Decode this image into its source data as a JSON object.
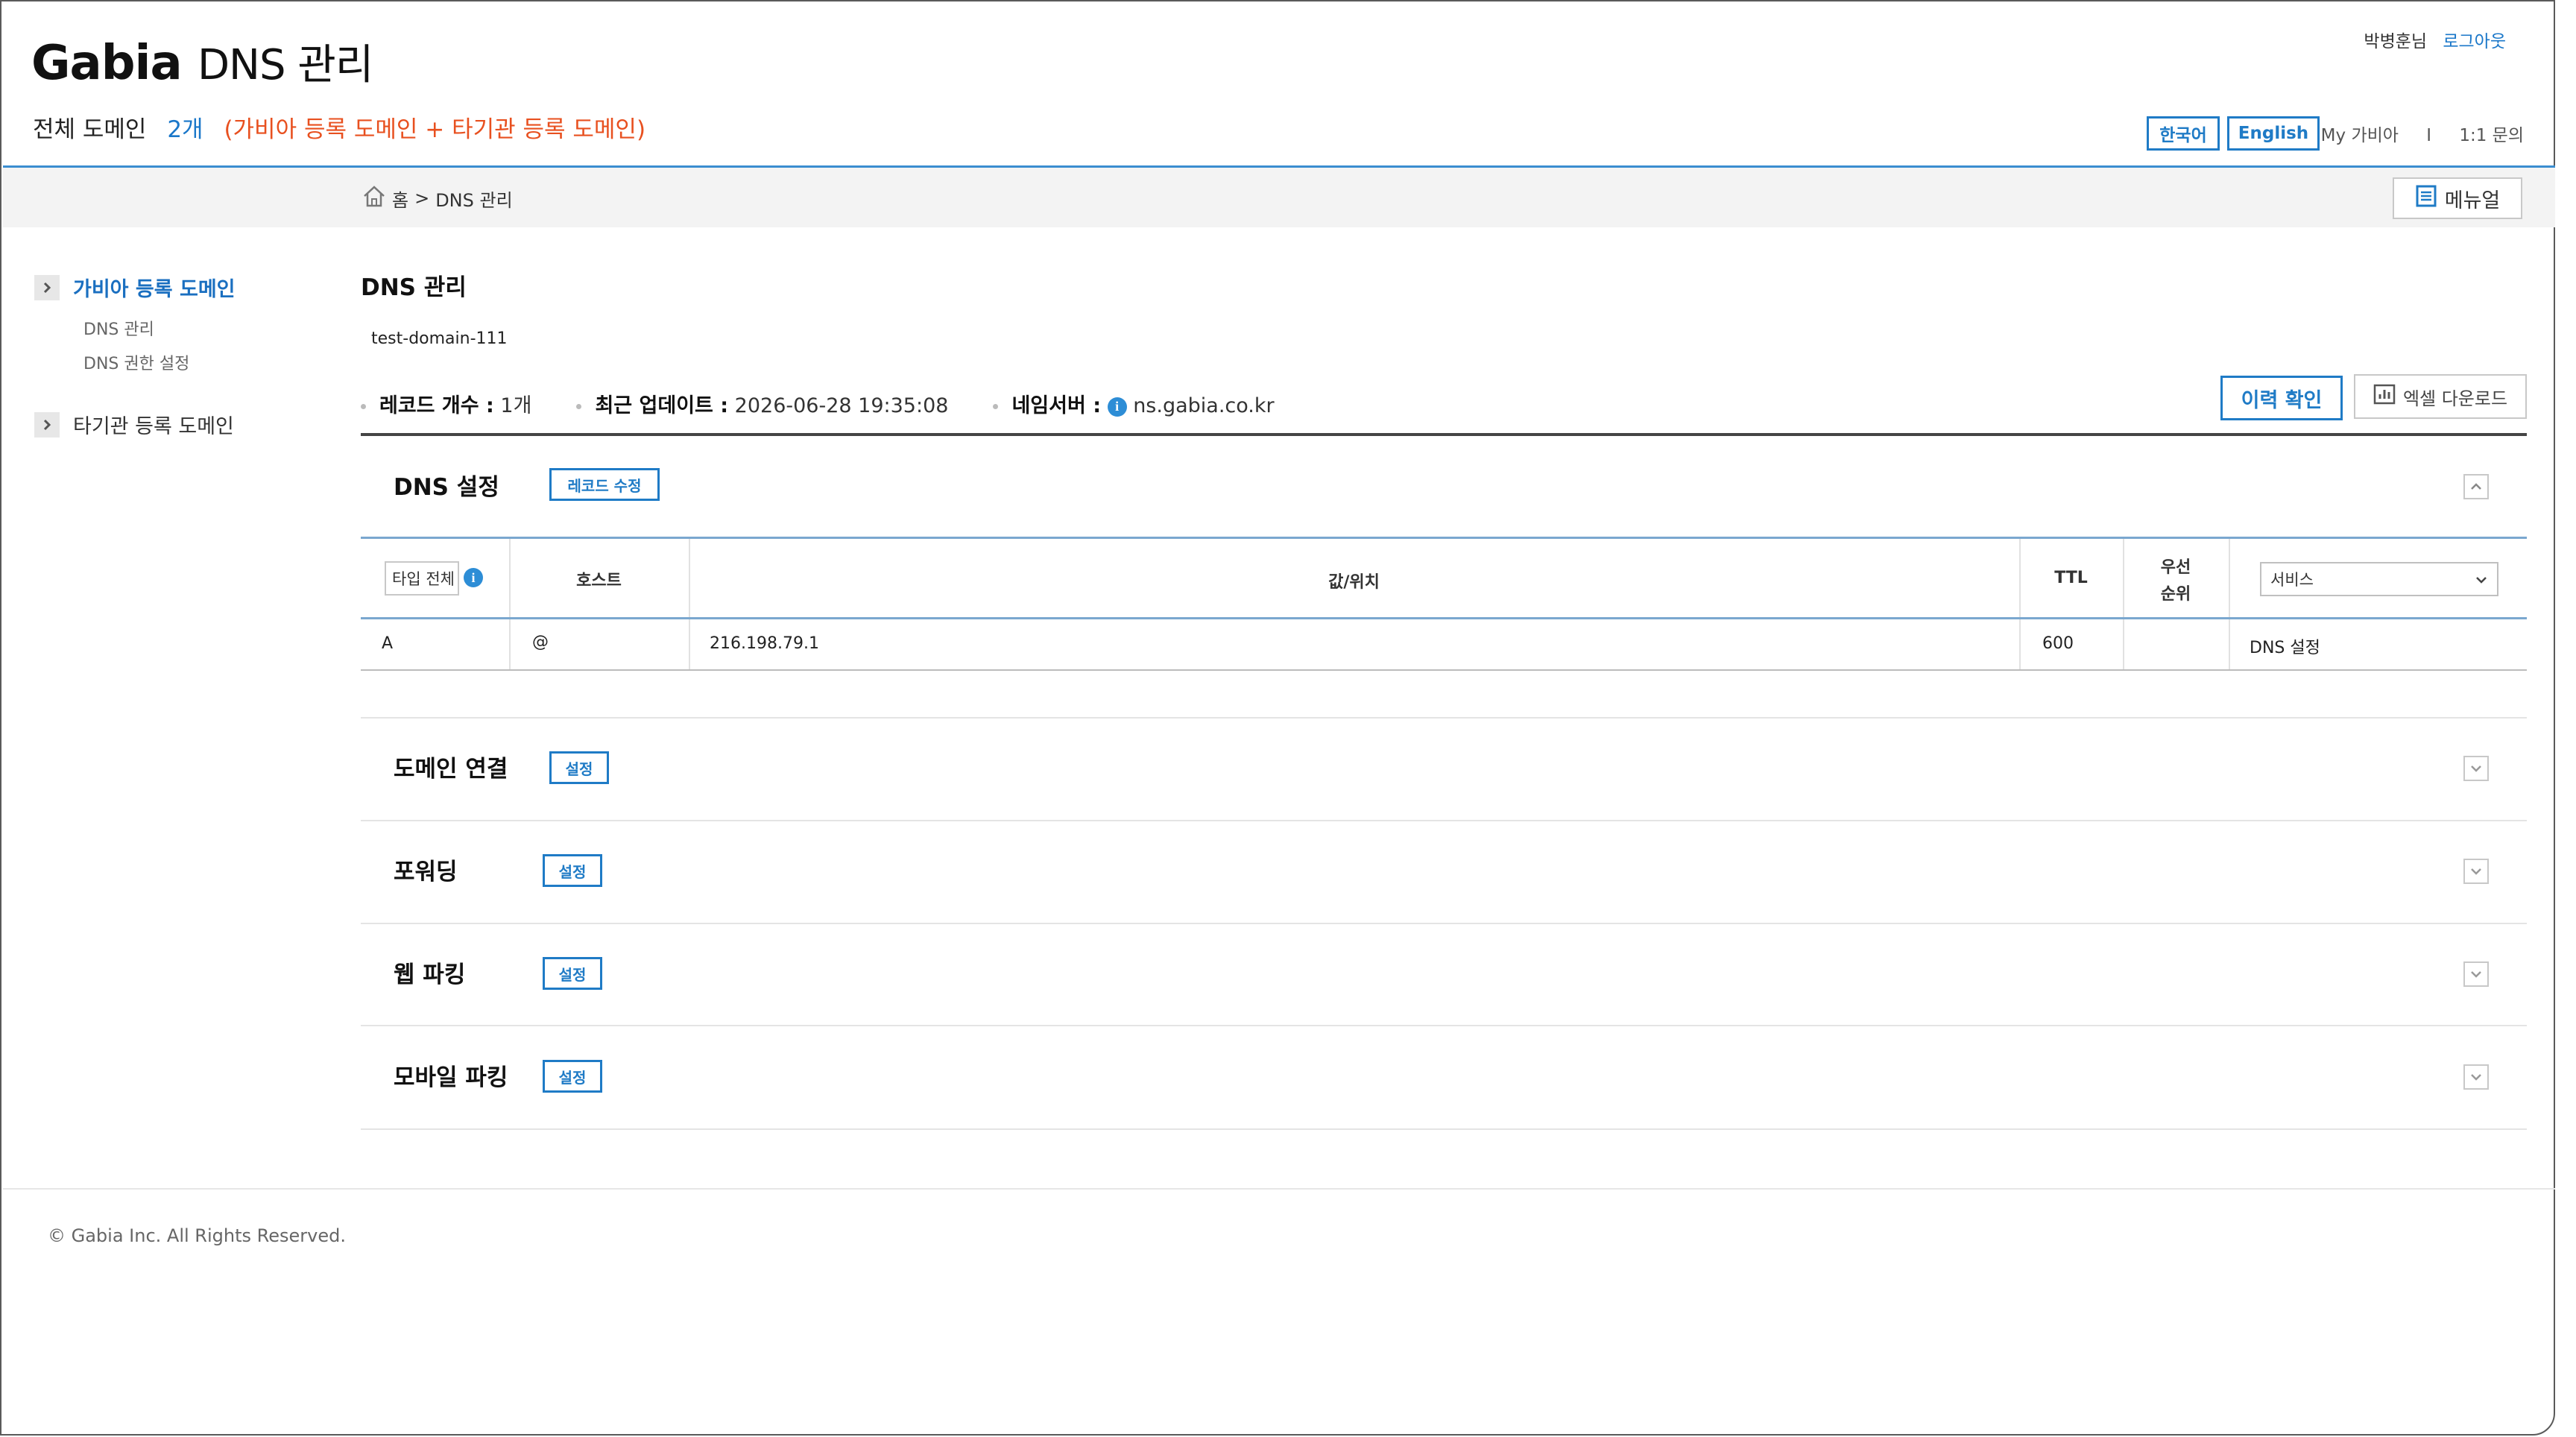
{
  "header": {
    "logo_brand": "Gabia",
    "logo_sub": "DNS 관리",
    "summary_label": "전체 도메인",
    "summary_count": "2개",
    "summary_note": "(가비아 등록 도메인 + 타기관 등록 도메인)",
    "user_name": "박병훈님",
    "logout": "로그아웃",
    "lang_korean": "한국어",
    "lang_english": "English",
    "my_gabia": "My 가비아",
    "separator": "I",
    "inquiry": "1:1 문의"
  },
  "breadcrumb": {
    "home": "홈",
    "sep": ">",
    "current": "DNS 관리",
    "manual_button": "메뉴얼"
  },
  "sidebar": {
    "items": [
      {
        "label": "가비아 등록 도메인",
        "active": true,
        "children": [
          {
            "label": "DNS 관리"
          },
          {
            "label": "DNS 권한 설정"
          }
        ]
      },
      {
        "label": "타기관 등록 도메인",
        "active": false
      }
    ]
  },
  "main": {
    "title": "DNS 관리",
    "domain": "test-domain-111",
    "meta": {
      "record_label": "레코드 개수 :",
      "record_value": "1개",
      "updated_label": "최근 업데이트 :",
      "updated_value": "2026-06-28 19:35:08",
      "ns_label": "네임서버 :",
      "ns_value": "ns.gabia.co.kr"
    },
    "history_button": "이력 확인",
    "excel_button": "엑셀 다운로드",
    "dns_section": {
      "title": "DNS 설정",
      "edit_button": "레코드 수정",
      "table": {
        "type_filter": "타입 전체",
        "headers": {
          "host": "호스트",
          "value": "값/위치",
          "ttl": "TTL",
          "priority_line1": "우선",
          "priority_line2": "순위"
        },
        "service_select": "서비스",
        "rows": [
          {
            "type": "A",
            "host": "@",
            "value": "216.198.79.1",
            "ttl": "600",
            "priority": "",
            "service": "DNS 설정"
          }
        ]
      }
    },
    "sections": [
      {
        "title": "도메인 연결",
        "button": "설정"
      },
      {
        "title": "포워딩",
        "button": "설정"
      },
      {
        "title": "웹 파킹",
        "button": "설정"
      },
      {
        "title": "모바일 파킹",
        "button": "설정"
      }
    ]
  },
  "footer": {
    "copyright": "© Gabia Inc. All Rights Reserved."
  },
  "colors": {
    "accent": "#1f7bc6",
    "note": "#e8501f",
    "topline": "#3b8dd0"
  },
  "icons": [
    "home-icon",
    "manual-doc-icon",
    "chevron-right-icon",
    "info-icon",
    "chart-icon",
    "chevron-up-icon",
    "chevron-down-icon"
  ]
}
